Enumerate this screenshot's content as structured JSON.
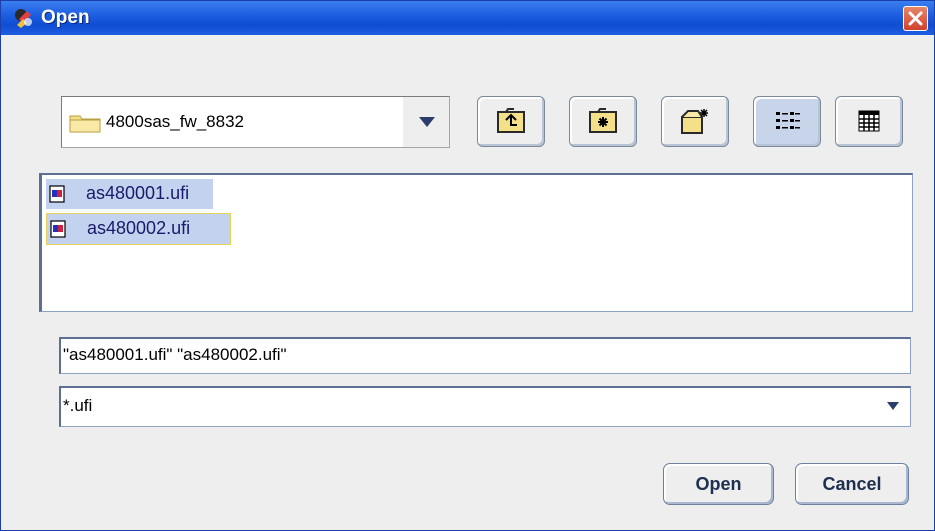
{
  "window": {
    "title": "Open"
  },
  "location": {
    "current_folder": "4800sas_fw_8832"
  },
  "toolbar": [
    {
      "name": "up-one-level-button",
      "icon": "folder-up-icon"
    },
    {
      "name": "home-button",
      "icon": "home-folder-icon"
    },
    {
      "name": "create-new-folder-button",
      "icon": "new-folder-icon"
    },
    {
      "name": "list-view-button",
      "icon": "list-view-icon",
      "pressed": true
    },
    {
      "name": "details-view-button",
      "icon": "details-view-icon"
    }
  ],
  "files": [
    {
      "name": "as480001.ufi",
      "selected": true
    },
    {
      "name": "as480002.ufi",
      "selected": true,
      "focused": true
    }
  ],
  "file_name_field": {
    "value": "\"as480001.ufi\" \"as480002.ufi\""
  },
  "file_type": {
    "selected": "*.ufi"
  },
  "buttons": {
    "open": "Open",
    "cancel": "Cancel"
  },
  "colors": {
    "title_bar": "#1d5fe0",
    "selection": "#c3d3ef",
    "focus_border": "#e6d45a"
  }
}
